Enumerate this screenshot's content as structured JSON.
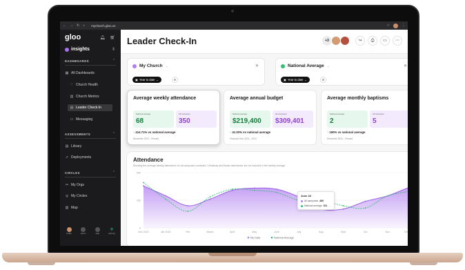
{
  "browser": {
    "url": "mychurch.gloo.us",
    "nav_icons": [
      "back-icon",
      "forward-icon",
      "reload-icon",
      "home-icon"
    ]
  },
  "sidebar": {
    "logo": "gloo",
    "app": "insights",
    "sections": [
      {
        "label": "DASHBOARDS",
        "items": [
          {
            "label": "All Dashboards",
            "icon": "grid-icon"
          },
          {
            "label": "Church Health",
            "icon": "heart-icon"
          },
          {
            "label": "Church Metrics",
            "icon": "bar-chart-icon"
          },
          {
            "label": "Leader Check-In",
            "icon": "clipboard-icon",
            "active": true
          },
          {
            "label": "Messaging",
            "icon": "chat-icon"
          }
        ]
      },
      {
        "label": "ASSESSMENTS",
        "items": [
          {
            "label": "Library",
            "icon": "library-icon"
          },
          {
            "label": "Deployments",
            "icon": "send-icon"
          }
        ]
      },
      {
        "label": "CIRCLES",
        "items": [
          {
            "label": "My Orgs",
            "icon": "org-icon"
          },
          {
            "label": "My Circles",
            "icon": "circles-icon"
          },
          {
            "label": "Map",
            "icon": "map-icon"
          }
        ]
      }
    ],
    "bottom": [
      {
        "label": "Profile",
        "icon": "avatar-icon"
      },
      {
        "label": "Admin",
        "icon": "lock-icon"
      },
      {
        "label": "Help",
        "icon": "help-icon"
      },
      {
        "label": "Add Org",
        "icon": "plus-icon"
      }
    ]
  },
  "header": {
    "title": "Leader Check-In",
    "extra_count": "+3"
  },
  "filters": [
    {
      "label": "My Church",
      "pill": "Year to date",
      "color": "#b07ef0"
    },
    {
      "label": "National Average",
      "pill": "Year to date",
      "color": "#2fbf74"
    }
  ],
  "stats": [
    {
      "title": "Average weekly attendance",
      "national_label": "National average",
      "national_value": "68",
      "campus_label": "All campuses",
      "campus_value": "350",
      "diff": "414.71%",
      "diff_text": "vs national average",
      "note": "December 2023 – Present"
    },
    {
      "title": "Average annual budget",
      "national_label": "National average",
      "national_value": "$219,400",
      "campus_label": "All campuses",
      "campus_value": "$309,401",
      "diff": "41.02%",
      "diff_text": "vs national average",
      "note": "Financial Year 2023 – 2024"
    },
    {
      "title": "Average monthly baptisms",
      "national_label": "National average",
      "national_value": "2",
      "campus_label": "All campuses",
      "campus_value": "5",
      "diff": "150%",
      "diff_text": "vs national average",
      "note": "December 2023 – Present"
    }
  ],
  "attendance": {
    "title": "Attendance",
    "subtitle": "Showing the average weekly attendance for all campuses combined. Christmas and Easter attendance are not included in the weekly average.",
    "tooltip": {
      "date": "June 23",
      "campus_label": "All campuses",
      "campus_value": "489",
      "national_label": "National average",
      "national_value": "321"
    }
  },
  "chart_data": {
    "type": "area",
    "categories": [
      "Dec 2023",
      "Jan 2024",
      "Feb",
      "March",
      "April",
      "May",
      "June",
      "July",
      "Aug",
      "Sept",
      "Oct",
      "Nov",
      "Dec 2024"
    ],
    "ylim": [
      0,
      500
    ],
    "yticks": [
      0,
      250,
      500
    ],
    "series": [
      {
        "name": "My Data",
        "values": [
          380,
          290,
          200,
          260,
          340,
          360,
          350,
          280,
          170,
          170,
          240,
          290,
          370
        ],
        "color": "#b07ef0"
      },
      {
        "name": "National Average",
        "values": [
          410,
          260,
          150,
          280,
          350,
          340,
          320,
          250,
          250,
          200,
          180,
          290,
          330
        ],
        "color": "#2fbf74"
      }
    ],
    "legend": "bottom"
  }
}
